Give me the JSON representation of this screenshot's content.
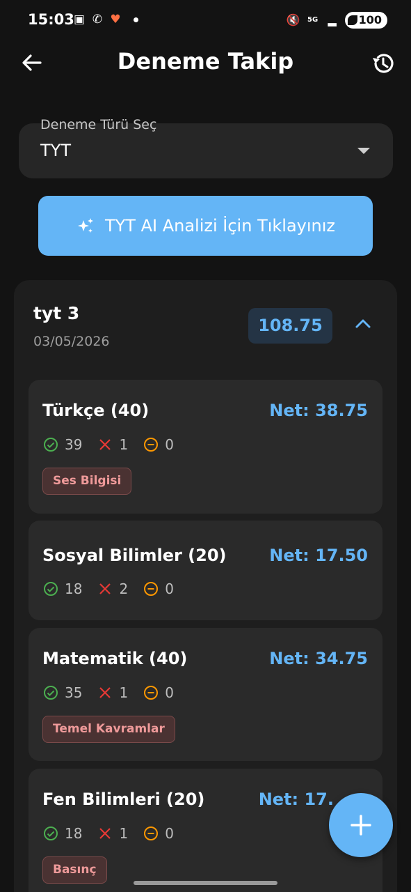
{
  "status_bar": {
    "time": "15:03",
    "battery": "100",
    "network": "5G"
  },
  "appbar": {
    "title": "Deneme Takip",
    "back_icon": "arrow-left-icon",
    "history_icon": "history-icon"
  },
  "dropdown": {
    "label": "Deneme Türü Seç",
    "value": "TYT"
  },
  "ai_button": {
    "label": "TYT AI Analizi İçin Tıklayınız",
    "icon": "sparkles-icon"
  },
  "exam": {
    "name": "tyt 3",
    "date": "03/05/2026",
    "total_net": "108.75",
    "subjects": [
      {
        "name": "Türkçe (40)",
        "net": "Net: 38.75",
        "correct": "39",
        "wrong": "1",
        "empty": "0",
        "tag": "Ses Bilgisi"
      },
      {
        "name": "Sosyal Bilimler (20)",
        "net": "Net: 17.50",
        "correct": "18",
        "wrong": "2",
        "empty": "0",
        "tag": ""
      },
      {
        "name": "Matematik (40)",
        "net": "Net: 34.75",
        "correct": "35",
        "wrong": "1",
        "empty": "0",
        "tag": "Temel Kavramlar"
      },
      {
        "name": "Fen Bilimleri (20)",
        "net": "Net: 17.",
        "correct": "18",
        "wrong": "1",
        "empty": "0",
        "tag": "Basınç"
      }
    ]
  },
  "colors": {
    "accent": "#64b5f6",
    "background": "#131313",
    "card": "#1e1e1e",
    "correct": "#4caf50",
    "wrong": "#e53935",
    "empty": "#ff9800"
  }
}
